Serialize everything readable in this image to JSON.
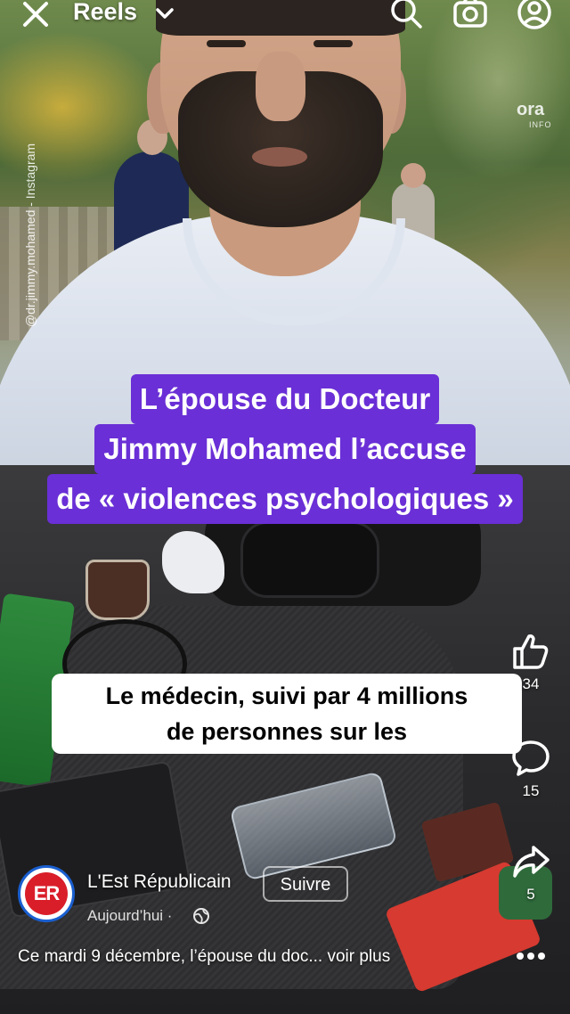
{
  "topbar": {
    "title": "Reels",
    "icons": [
      "close-icon",
      "chevron-down-icon",
      "search-icon",
      "camera-icon",
      "profile-icon"
    ]
  },
  "video": {
    "watermark": "@dr.jimmy.mohamed - Instagram",
    "source_logo": "ora",
    "source_logo_sub": "INFO",
    "headline": {
      "line1": "L’épouse du Docteur",
      "line2": "Jimmy Mohamed l’accuse",
      "line3": "de « violences psychologiques »"
    },
    "subtitle": {
      "line1": "Le médecin, suivi par 4 millions",
      "line2": "de personnes sur les"
    }
  },
  "actions": {
    "likes": "34",
    "comments": "15",
    "shares": "5"
  },
  "post": {
    "avatar_text": "ER",
    "account_name": "L'Est Républicain",
    "follow_label": "Suivre",
    "date": "Aujourd’hui ·",
    "caption": "Ce mardi 9 décembre, l’épouse du doc... voir plus"
  },
  "colors": {
    "headline_bg": "#6a2fd6",
    "avatar_red": "#d91e2a",
    "avatar_ring": "#1a5fd0"
  }
}
